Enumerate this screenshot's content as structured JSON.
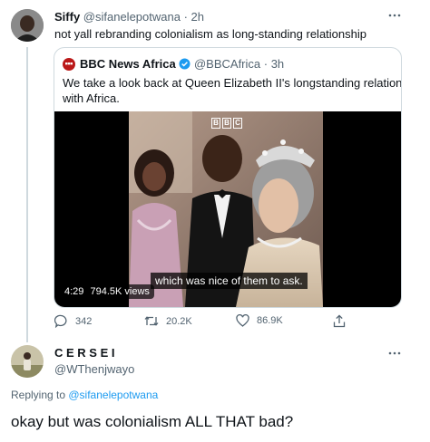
{
  "tweet": {
    "display_name": "Siffy",
    "handle": "@sifanelepotwana",
    "time": "· 2h",
    "text": "not yall rebranding colonialism as long-standing relationship",
    "more_icon": "more-horizontal-icon",
    "quoted": {
      "display_name": "BBC News Africa",
      "verified_icon": "verified-badge-icon",
      "handle": "@BBCAfrica",
      "time": "· 3h",
      "text_line1": "We take a look back at Queen Elizabeth II's longstanding relationship",
      "text_line2": "with Africa.",
      "video": {
        "logo_letters": [
          "B",
          "B",
          "C"
        ],
        "subtitle": "which was nice of them to ask.",
        "duration": "4:29",
        "views": "794.5K views"
      }
    },
    "actions": {
      "reply": {
        "icon": "reply-icon",
        "count": "342"
      },
      "retweet": {
        "icon": "retweet-icon",
        "count": "20.2K"
      },
      "like": {
        "icon": "heart-icon",
        "count": "86.9K"
      },
      "share": {
        "icon": "share-icon"
      }
    }
  },
  "reply": {
    "display_name": "C E R S E I",
    "handle": "@WThenjwayo",
    "replying_prefix": "Replying to ",
    "replying_to": "@sifanelepotwana",
    "text": "okay but was colonialism ALL THAT bad?",
    "more_icon": "more-horizontal-icon"
  },
  "colors": {
    "link": "#1d9bf0",
    "muted": "#536471",
    "border": "#cfd9de",
    "bbc_red": "#bb1919"
  }
}
